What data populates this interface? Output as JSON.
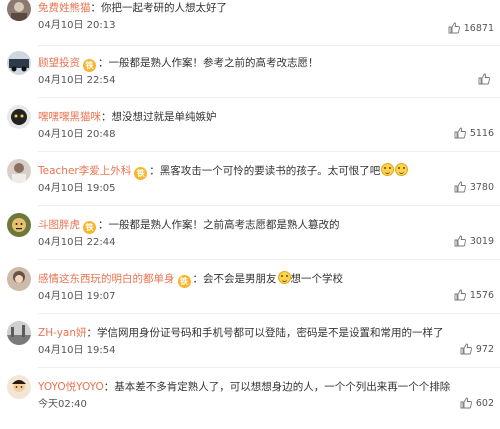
{
  "comments": [
    {
      "user": "免费姓熊猫",
      "text": "你把一起考研的人想太好了",
      "badge": "",
      "badge_icon": "",
      "has_emoji": false,
      "emoji_count": 0,
      "date": "04月10日 20:13",
      "likes": "16871",
      "avatar_color": "#8a7a70"
    },
    {
      "user": "顾望投资",
      "text": "一般都是熟人作案！参考之前的高考改志愿！",
      "badge": "铁",
      "badge_icon": "fan-badge-icon",
      "has_emoji": false,
      "emoji_count": 0,
      "date": "04月10日 22:54",
      "likes": "",
      "avatar_color": "#4f5e73"
    },
    {
      "user": "嘿嘿嘿黑猫咪",
      "text": "想没想过就是单纯嫉妒",
      "badge": "",
      "badge_icon": "",
      "has_emoji": false,
      "emoji_count": 0,
      "date": "04月10日 20:48",
      "likes": "5116",
      "avatar_color": "#222222"
    },
    {
      "user": "Teacher李爱上外科",
      "text": "黑客攻击一个可怜的要读书的孩子。太可恨了吧",
      "badge": "铁",
      "badge_icon": "fan-badge-icon",
      "has_emoji": true,
      "emoji_count": 2,
      "date": "04月10日 19:05",
      "likes": "3780",
      "avatar_color": "#a89c90"
    },
    {
      "user": "斗图胖虎",
      "text": "一般都是熟人作案！之前高考志愿都是熟人篡改的",
      "badge": "铁",
      "badge_icon": "fan-badge-icon",
      "has_emoji": false,
      "emoji_count": 0,
      "date": "04月10日 22:44",
      "likes": "3019",
      "avatar_color": "#6b7a3a"
    },
    {
      "user": "感情这东西玩的明白的都单身",
      "text": "会不会是男朋友",
      "text2": "想一个学校",
      "badge": "铁",
      "badge_icon": "fan-badge-icon",
      "has_emoji": true,
      "emoji_count": 1,
      "date": "04月10日 19:07",
      "likes": "1576",
      "avatar_color": "#b8a898"
    },
    {
      "user": "ZH-yan妍",
      "text": "学信网用身份证号码和手机号都可以登陆，密码是不是设置和常用的一样了",
      "badge": "",
      "badge_icon": "",
      "has_emoji": false,
      "emoji_count": 0,
      "date": "04月10日 19:54",
      "likes": "972",
      "avatar_color": "#9a9a9a"
    },
    {
      "user": "YOYO悦YOYO",
      "text": "基本差不多肯定熟人了，可以想想身边的人，一个个列出来再一个个排除",
      "badge": "",
      "badge_icon": "",
      "has_emoji": false,
      "emoji_count": 0,
      "date": "今天02:40",
      "likes": "602",
      "avatar_color": "#c79a6a"
    }
  ]
}
